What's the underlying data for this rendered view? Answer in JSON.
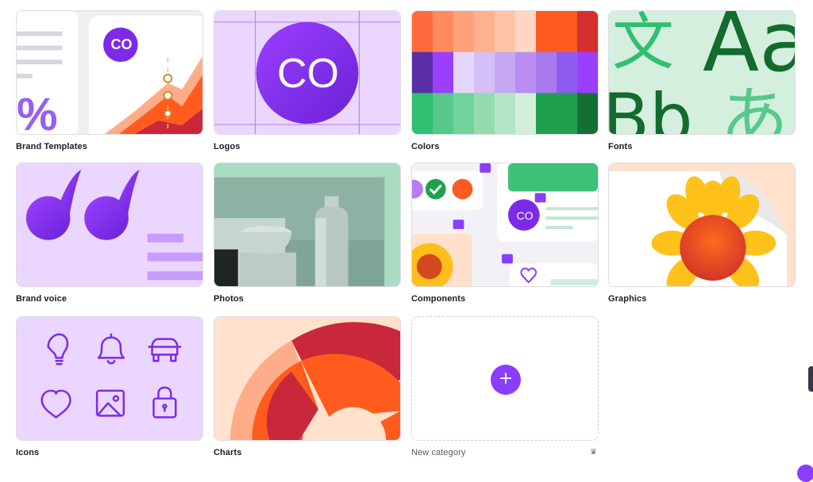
{
  "categories": [
    {
      "label": "Brand Templates",
      "logo": "CO"
    },
    {
      "label": "Logos",
      "logo": "CO"
    },
    {
      "label": "Colors"
    },
    {
      "label": "Fonts",
      "glyphs": [
        "文",
        "Aa",
        "Bb",
        "あ"
      ]
    },
    {
      "label": "Brand voice"
    },
    {
      "label": "Photos"
    },
    {
      "label": "Components",
      "logo": "CO"
    },
    {
      "label": "Graphics"
    },
    {
      "label": "Icons"
    },
    {
      "label": "Charts"
    },
    {
      "label": "New category",
      "plus": "+",
      "badge": "♛"
    }
  ],
  "brand_templates": {
    "percent": "%"
  },
  "colors": {
    "accent": "#8b3dff",
    "palette_top": [
      "#ff6a3d",
      "#ff8a5b",
      "#ffa07a",
      "#ffb18f",
      "#ffc4a8",
      "#ffd6c2",
      "#ff5a1f",
      "#ff5a1f",
      "#d62f2f"
    ],
    "palette_mid": [
      "#5a2ea6",
      "#9b3fff",
      "#e4d6fb",
      "#d4bff7",
      "#c7a8f3",
      "#b98ef0",
      "#a979ee",
      "#8e5cf0",
      "#9b3fff"
    ],
    "palette_bottom": [
      "#2fbf71",
      "#56c98a",
      "#74d29c",
      "#93dcb0",
      "#b2e6c5",
      "#d3efdc",
      "#1fa04e",
      "#1fa04e",
      "#156f35"
    ]
  },
  "icons": [
    "lightbulb-icon",
    "bell-icon",
    "car-icon",
    "heart-icon",
    "image-icon",
    "lock-icon"
  ]
}
